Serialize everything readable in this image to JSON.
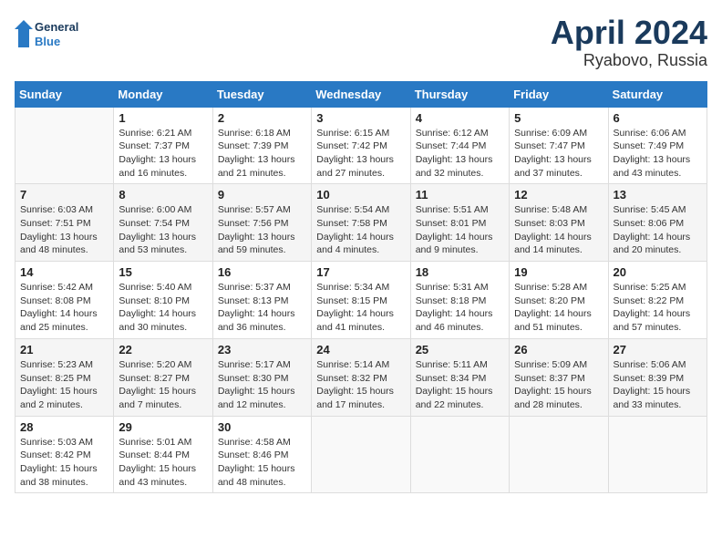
{
  "header": {
    "logo_line1": "General",
    "logo_line2": "Blue",
    "title": "April 2024",
    "subtitle": "Ryabovo, Russia"
  },
  "days_of_week": [
    "Sunday",
    "Monday",
    "Tuesday",
    "Wednesday",
    "Thursday",
    "Friday",
    "Saturday"
  ],
  "weeks": [
    [
      {
        "day": "",
        "info": ""
      },
      {
        "day": "1",
        "info": "Sunrise: 6:21 AM\nSunset: 7:37 PM\nDaylight: 13 hours\nand 16 minutes."
      },
      {
        "day": "2",
        "info": "Sunrise: 6:18 AM\nSunset: 7:39 PM\nDaylight: 13 hours\nand 21 minutes."
      },
      {
        "day": "3",
        "info": "Sunrise: 6:15 AM\nSunset: 7:42 PM\nDaylight: 13 hours\nand 27 minutes."
      },
      {
        "day": "4",
        "info": "Sunrise: 6:12 AM\nSunset: 7:44 PM\nDaylight: 13 hours\nand 32 minutes."
      },
      {
        "day": "5",
        "info": "Sunrise: 6:09 AM\nSunset: 7:47 PM\nDaylight: 13 hours\nand 37 minutes."
      },
      {
        "day": "6",
        "info": "Sunrise: 6:06 AM\nSunset: 7:49 PM\nDaylight: 13 hours\nand 43 minutes."
      }
    ],
    [
      {
        "day": "7",
        "info": "Sunrise: 6:03 AM\nSunset: 7:51 PM\nDaylight: 13 hours\nand 48 minutes."
      },
      {
        "day": "8",
        "info": "Sunrise: 6:00 AM\nSunset: 7:54 PM\nDaylight: 13 hours\nand 53 minutes."
      },
      {
        "day": "9",
        "info": "Sunrise: 5:57 AM\nSunset: 7:56 PM\nDaylight: 13 hours\nand 59 minutes."
      },
      {
        "day": "10",
        "info": "Sunrise: 5:54 AM\nSunset: 7:58 PM\nDaylight: 14 hours\nand 4 minutes."
      },
      {
        "day": "11",
        "info": "Sunrise: 5:51 AM\nSunset: 8:01 PM\nDaylight: 14 hours\nand 9 minutes."
      },
      {
        "day": "12",
        "info": "Sunrise: 5:48 AM\nSunset: 8:03 PM\nDaylight: 14 hours\nand 14 minutes."
      },
      {
        "day": "13",
        "info": "Sunrise: 5:45 AM\nSunset: 8:06 PM\nDaylight: 14 hours\nand 20 minutes."
      }
    ],
    [
      {
        "day": "14",
        "info": "Sunrise: 5:42 AM\nSunset: 8:08 PM\nDaylight: 14 hours\nand 25 minutes."
      },
      {
        "day": "15",
        "info": "Sunrise: 5:40 AM\nSunset: 8:10 PM\nDaylight: 14 hours\nand 30 minutes."
      },
      {
        "day": "16",
        "info": "Sunrise: 5:37 AM\nSunset: 8:13 PM\nDaylight: 14 hours\nand 36 minutes."
      },
      {
        "day": "17",
        "info": "Sunrise: 5:34 AM\nSunset: 8:15 PM\nDaylight: 14 hours\nand 41 minutes."
      },
      {
        "day": "18",
        "info": "Sunrise: 5:31 AM\nSunset: 8:18 PM\nDaylight: 14 hours\nand 46 minutes."
      },
      {
        "day": "19",
        "info": "Sunrise: 5:28 AM\nSunset: 8:20 PM\nDaylight: 14 hours\nand 51 minutes."
      },
      {
        "day": "20",
        "info": "Sunrise: 5:25 AM\nSunset: 8:22 PM\nDaylight: 14 hours\nand 57 minutes."
      }
    ],
    [
      {
        "day": "21",
        "info": "Sunrise: 5:23 AM\nSunset: 8:25 PM\nDaylight: 15 hours\nand 2 minutes."
      },
      {
        "day": "22",
        "info": "Sunrise: 5:20 AM\nSunset: 8:27 PM\nDaylight: 15 hours\nand 7 minutes."
      },
      {
        "day": "23",
        "info": "Sunrise: 5:17 AM\nSunset: 8:30 PM\nDaylight: 15 hours\nand 12 minutes."
      },
      {
        "day": "24",
        "info": "Sunrise: 5:14 AM\nSunset: 8:32 PM\nDaylight: 15 hours\nand 17 minutes."
      },
      {
        "day": "25",
        "info": "Sunrise: 5:11 AM\nSunset: 8:34 PM\nDaylight: 15 hours\nand 22 minutes."
      },
      {
        "day": "26",
        "info": "Sunrise: 5:09 AM\nSunset: 8:37 PM\nDaylight: 15 hours\nand 28 minutes."
      },
      {
        "day": "27",
        "info": "Sunrise: 5:06 AM\nSunset: 8:39 PM\nDaylight: 15 hours\nand 33 minutes."
      }
    ],
    [
      {
        "day": "28",
        "info": "Sunrise: 5:03 AM\nSunset: 8:42 PM\nDaylight: 15 hours\nand 38 minutes."
      },
      {
        "day": "29",
        "info": "Sunrise: 5:01 AM\nSunset: 8:44 PM\nDaylight: 15 hours\nand 43 minutes."
      },
      {
        "day": "30",
        "info": "Sunrise: 4:58 AM\nSunset: 8:46 PM\nDaylight: 15 hours\nand 48 minutes."
      },
      {
        "day": "",
        "info": ""
      },
      {
        "day": "",
        "info": ""
      },
      {
        "day": "",
        "info": ""
      },
      {
        "day": "",
        "info": ""
      }
    ]
  ]
}
